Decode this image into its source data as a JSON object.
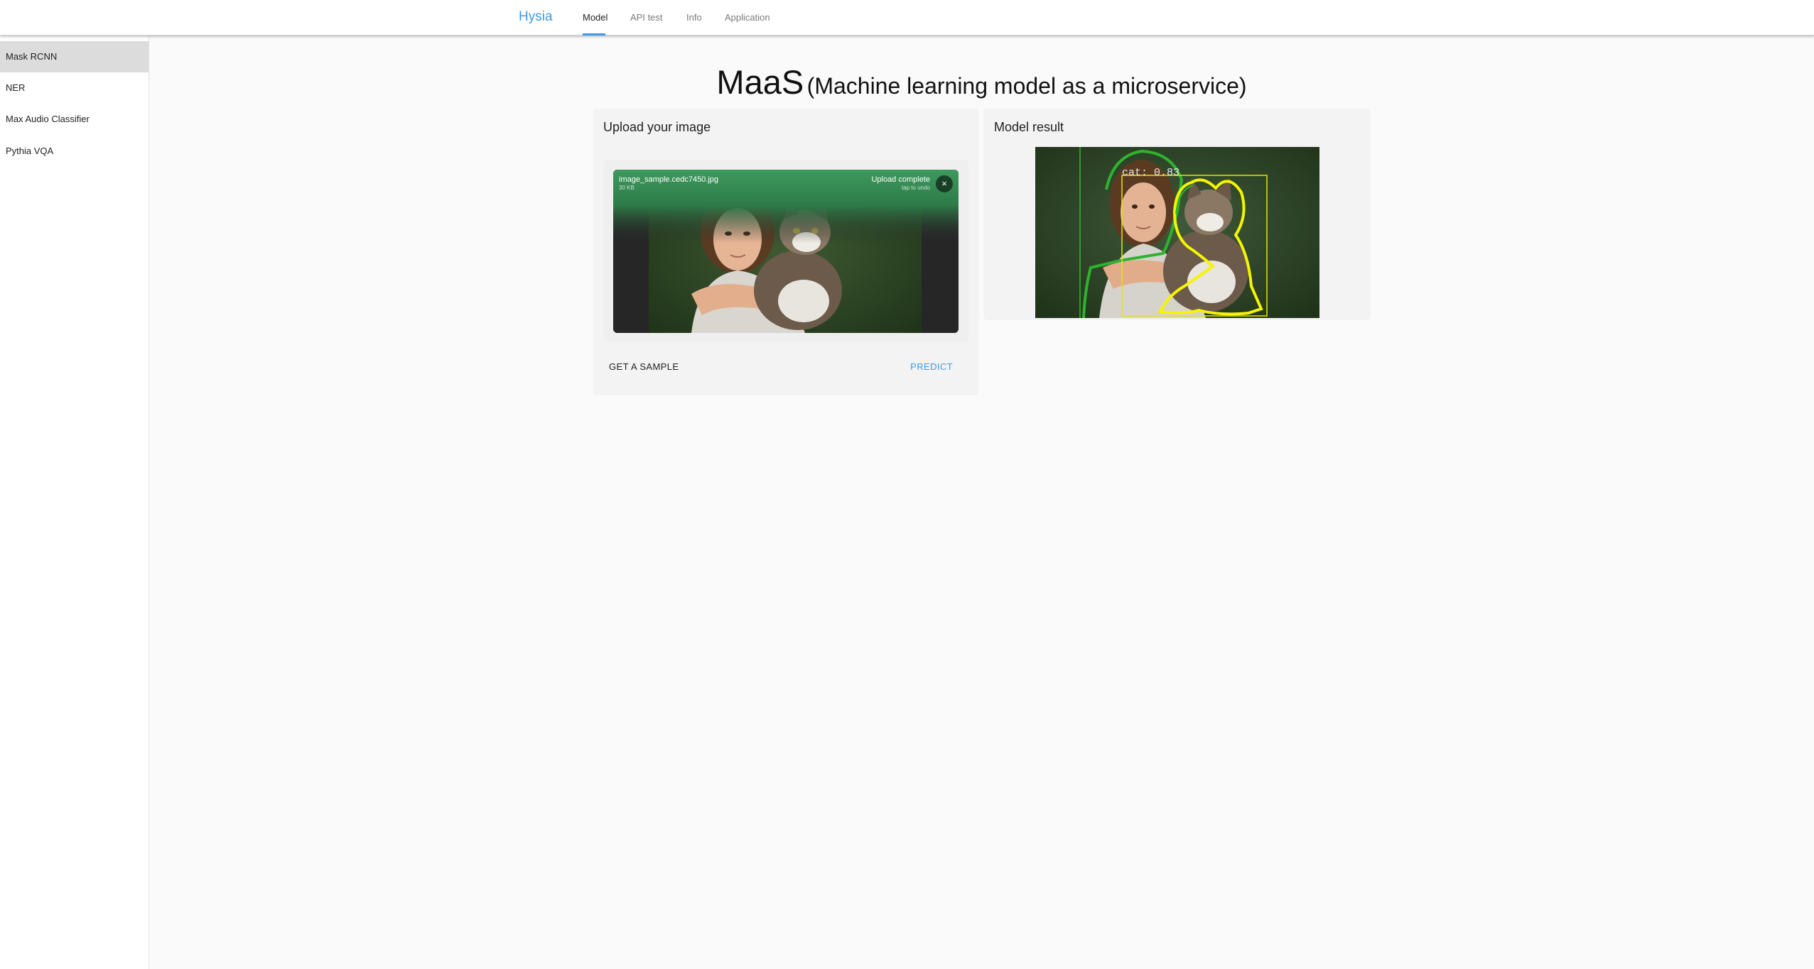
{
  "app": {
    "brand": "Hysia",
    "tabs": [
      {
        "label": "Model",
        "active": true
      },
      {
        "label": "API test"
      },
      {
        "label": "Info"
      },
      {
        "label": "Application"
      }
    ]
  },
  "sidebar": {
    "items": [
      {
        "label": "Mask RCNN",
        "active": true
      },
      {
        "label": "NER"
      },
      {
        "label": "Max Audio Classifier"
      },
      {
        "label": "Pythia VQA"
      }
    ]
  },
  "headline": {
    "main": "MaaS",
    "sub": "(Machine learning model as a microservice)"
  },
  "upload": {
    "title": "Upload your image",
    "file_name": "image_sample.cedc7450.jpg",
    "file_size": "30 KB",
    "status": "Upload complete",
    "status_hint": "tap to undo",
    "close_icon": "×",
    "sample_button": "GET A SAMPLE",
    "predict_button": "PREDICT"
  },
  "result": {
    "title": "Model result",
    "detection_label": "cat: 0.83"
  },
  "colors": {
    "accent": "#3f9ae6",
    "upload_success": "#3d9a5e",
    "mask_yellow": "#f5f500",
    "mask_green": "#2fb32f"
  }
}
